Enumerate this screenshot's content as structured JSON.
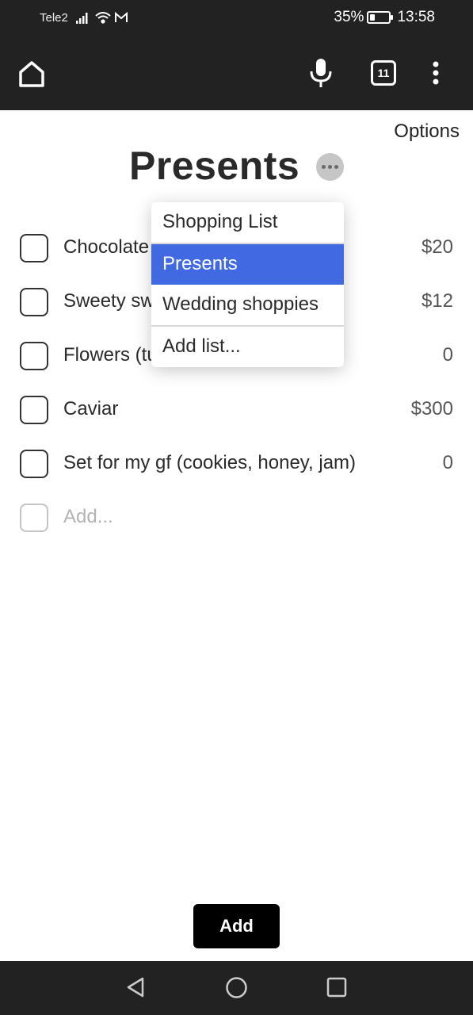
{
  "status_bar": {
    "carrier": "Tele2",
    "battery_percent": "35%",
    "battery_level": 0.35,
    "time": "13:58",
    "icons": [
      "signal-icon",
      "wifi-icon",
      "gmail-icon",
      "battery-icon"
    ]
  },
  "browser": {
    "tab_count": "11",
    "icons": [
      "home-icon",
      "mic-icon",
      "tabs-icon",
      "more-vert-icon"
    ]
  },
  "page": {
    "options_label": "Options",
    "title": "Presents"
  },
  "items": [
    {
      "name": "Chocolate",
      "price": "$20"
    },
    {
      "name": "Sweety sweets",
      "price": "$12"
    },
    {
      "name": "Flowers (tulips, lily)",
      "price": "0"
    },
    {
      "name": "Caviar",
      "price": "$300"
    },
    {
      "name": "Set for my gf (cookies, honey, jam)",
      "price": "0"
    }
  ],
  "add_placeholder": "Add...",
  "dropdown": {
    "lists": [
      "Shopping List",
      "Presents",
      "Wedding shoppies"
    ],
    "selected": "Presents",
    "add_list_label": "Add list..."
  },
  "add_button_label": "Add",
  "colors": {
    "bar_background": "#222222",
    "selected_highlight": "#4169e1",
    "add_button": "#000000"
  },
  "nav_bar": {
    "icons": [
      "back-icon",
      "home-circle-icon",
      "recent-apps-icon"
    ]
  }
}
